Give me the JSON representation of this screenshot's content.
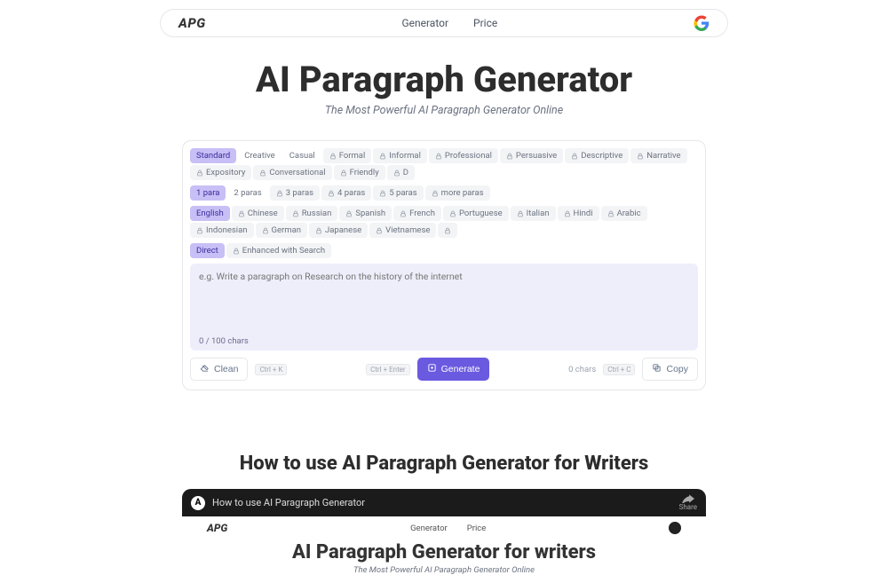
{
  "nav": {
    "logo": "APG",
    "links": [
      "Generator",
      "Price"
    ]
  },
  "hero": {
    "title": "AI Paragraph Generator",
    "subtitle": "The Most Powerful AI Paragraph Generator Online"
  },
  "panel": {
    "styles": {
      "active": "Standard",
      "alt": [
        "Creative",
        "Casual"
      ],
      "locked": [
        "Formal",
        "Informal",
        "Professional",
        "Persuasive",
        "Descriptive",
        "Narrative",
        "Expository",
        "Conversational",
        "Friendly",
        "D"
      ]
    },
    "paras": {
      "active": "1 para",
      "alt": [
        "2 paras"
      ],
      "locked": [
        "3 paras",
        "4 paras",
        "5 paras",
        "more paras"
      ]
    },
    "langs": {
      "active": "English",
      "locked": [
        "Chinese",
        "Russian",
        "Spanish",
        "French",
        "Portuguese",
        "Italian",
        "Hindi",
        "Arabic",
        "Indonesian",
        "German",
        "Japanese",
        "Vietnamese"
      ]
    },
    "modes": {
      "active": "Direct",
      "locked": [
        "Enhanced with Search"
      ]
    },
    "input": {
      "placeholder": "e.g. Write a paragraph on Research on the history of the internet",
      "charcount": "0 / 100 chars"
    },
    "actions": {
      "clean": "Clean",
      "clean_shortcut": "Ctrl + K",
      "generate": "Generate",
      "generate_shortcut": "Ctrl + Enter",
      "out_chars": "0 chars",
      "copy": "Copy",
      "copy_shortcut": "Ctrl + C"
    }
  },
  "howto": {
    "title": "How to use AI Paragraph Generator for Writers",
    "video_title": "How to use AI Paragraph Generator",
    "share": "Share",
    "body": {
      "logo": "APG",
      "links": [
        "Generator",
        "Price"
      ],
      "title": "AI Paragraph Generator for writers",
      "subtitle": "The Most Powerful AI Paragraph Generator Online"
    }
  }
}
